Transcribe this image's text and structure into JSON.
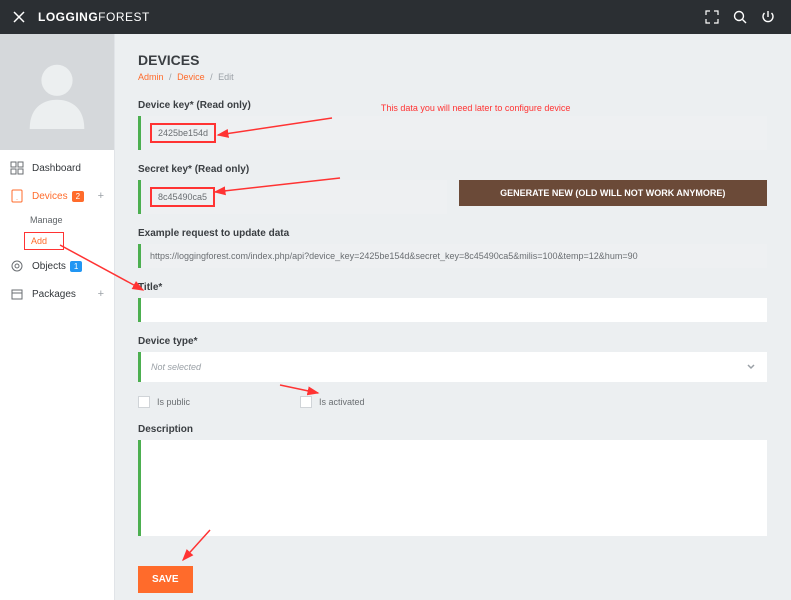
{
  "header": {
    "brand_bold": "LOGGING",
    "brand_light": "FOREST"
  },
  "sidebar": {
    "items": [
      {
        "label": "Dashboard"
      },
      {
        "label": "Devices",
        "badge": "2"
      },
      {
        "label": "Objects",
        "badge": "1"
      },
      {
        "label": "Packages"
      }
    ],
    "sub_manage": "Manage",
    "sub_add": "Add"
  },
  "page": {
    "title": "DEVICES",
    "bc_admin": "Admin",
    "bc_device": "Device",
    "bc_edit": "Edit"
  },
  "note": "This data you will need later to configure device",
  "device_key": {
    "label": "Device key* (Read only)",
    "value": "2425be154d"
  },
  "secret_key": {
    "label": "Secret key* (Read only)",
    "value": "8c45490ca5"
  },
  "gen_btn": "GENERATE NEW (OLD WILL NOT WORK ANYMORE)",
  "example": {
    "label": "Example request to update data",
    "value": "https://loggingforest.com/index.php/api?device_key=2425be154d&secret_key=8c45490ca5&milis=100&temp=12&hum=90"
  },
  "title_field": {
    "label": "Title*",
    "value": ""
  },
  "device_type": {
    "label": "Device type*",
    "selected": "Not selected"
  },
  "is_public": "Is public",
  "is_activated": "Is activated",
  "description": {
    "label": "Description",
    "value": ""
  },
  "save": "SAVE"
}
